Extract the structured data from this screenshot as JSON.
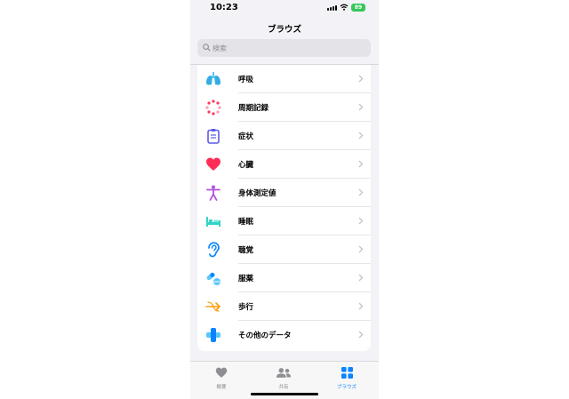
{
  "status_bar": {
    "time": "10:23",
    "battery": "89"
  },
  "nav": {
    "title": "ブラウズ"
  },
  "search": {
    "placeholder": "検索"
  },
  "categories": [
    {
      "label": "呼吸",
      "icon": "lungs-icon",
      "color": "#32ade6"
    },
    {
      "label": "周期記録",
      "icon": "cycle-tracking-icon",
      "color": "#ff375f"
    },
    {
      "label": "症状",
      "icon": "clipboard-icon",
      "color": "#5e5ce6"
    },
    {
      "label": "心臓",
      "icon": "heart-icon",
      "color": "#ff2d55"
    },
    {
      "label": "身体測定値",
      "icon": "body-figure-icon",
      "color": "#af52de"
    },
    {
      "label": "睡眠",
      "icon": "bed-icon",
      "color": "#30d5c8"
    },
    {
      "label": "聴覚",
      "icon": "ear-icon",
      "color": "#0a84ff"
    },
    {
      "label": "服薬",
      "icon": "pills-icon",
      "color": "#5ac8fa"
    },
    {
      "label": "歩行",
      "icon": "walking-arrows-icon",
      "color": "#ff9f0a"
    },
    {
      "label": "その他のデータ",
      "icon": "plus-cross-icon",
      "color": "#0a84ff"
    }
  ],
  "tab_bar": {
    "tabs": [
      {
        "label": "概要",
        "icon": "heart-icon",
        "active": false
      },
      {
        "label": "共有",
        "icon": "people-icon",
        "active": false
      },
      {
        "label": "ブラウズ",
        "icon": "grid-icon",
        "active": true
      }
    ],
    "active_color": "#0a84ff",
    "inactive_color": "#8e8e93"
  }
}
